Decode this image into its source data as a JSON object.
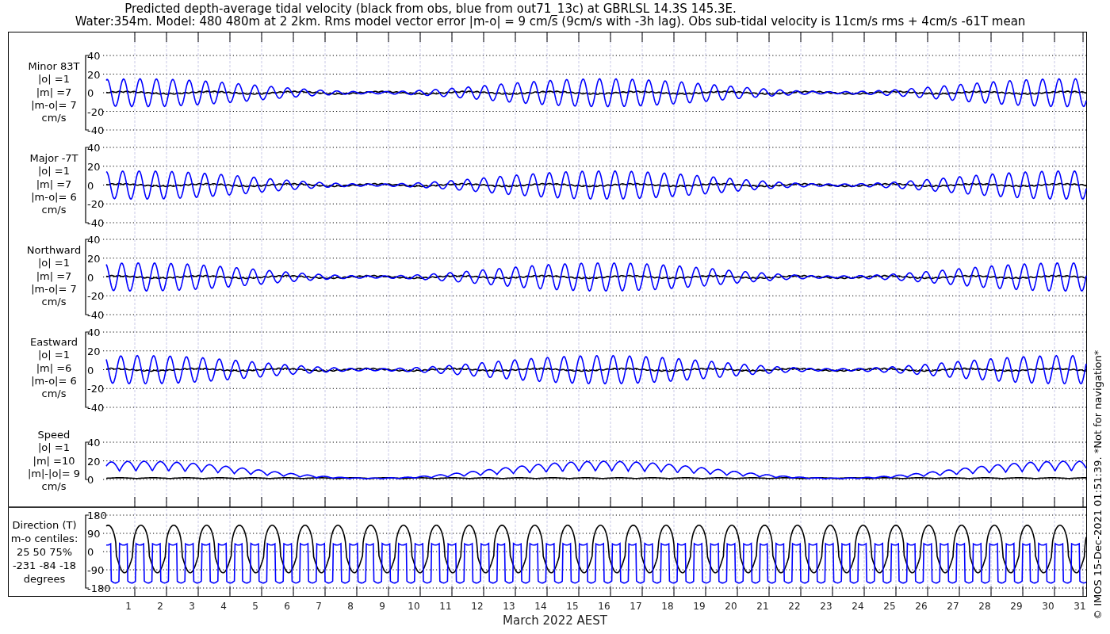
{
  "title_lines": [
    "Predicted depth-average tidal velocity (black from obs, blue from out71_13c) at GBRLSL 14.3S 145.3E.",
    "Water:354m. Model: 480 480m at 2 2km. Rms model vector error |m-o| = 9 cm/s (9cm/s with -3h lag). Obs sub-tidal velocity is 11cm/s rms + 4cm/s -61T mean"
  ],
  "panels": [
    {
      "kind": "signed",
      "label_lines": [
        "Minor 83T",
        "|o| =1",
        "|m| =7",
        "|m-o|= 7",
        "cm/s"
      ],
      "yticks": [
        "40",
        "20",
        "0",
        "-20",
        "-40"
      ]
    },
    {
      "kind": "signed",
      "label_lines": [
        "Major -7T",
        "|o| =1",
        "|m| =7",
        "|m-o|= 6",
        "cm/s"
      ],
      "yticks": [
        "40",
        "20",
        "0",
        "-20",
        "-40"
      ]
    },
    {
      "kind": "signed",
      "label_lines": [
        "Northward",
        "|o| =1",
        "|m| =7",
        "|m-o|= 7",
        "cm/s"
      ],
      "yticks": [
        "40",
        "20",
        "0",
        "-20",
        "-40"
      ]
    },
    {
      "kind": "signed",
      "label_lines": [
        "Eastward",
        "|o| =1",
        "|m| =6",
        "|m-o|= 6",
        "cm/s"
      ],
      "yticks": [
        "40",
        "20",
        "0",
        "-20",
        "-40"
      ]
    },
    {
      "kind": "speed",
      "label_lines": [
        "Speed",
        "|o| =1",
        "|m| =10",
        "|m|-|o|= 9",
        "cm/s"
      ],
      "yticks": [
        "40",
        "20",
        "0"
      ]
    },
    {
      "kind": "direction",
      "label_lines": [
        "Direction (T)",
        "m-o centiles:",
        "25  50  75%",
        "-231  -84  -18",
        "degrees"
      ],
      "yticks": [
        "180",
        "90",
        "0",
        "-90",
        "-180"
      ]
    }
  ],
  "xticks": [
    "1",
    "2",
    "3",
    "4",
    "5",
    "6",
    "7",
    "8",
    "9",
    "10",
    "11",
    "12",
    "13",
    "14",
    "15",
    "16",
    "17",
    "18",
    "19",
    "20",
    "21",
    "22",
    "23",
    "24",
    "25",
    "26",
    "27",
    "28",
    "29",
    "30",
    "31"
  ],
  "xlabel": "March 2022 AEST",
  "credit": "© IMOS 15-Dec-2021 01:51:39. *Not for navigation*"
}
